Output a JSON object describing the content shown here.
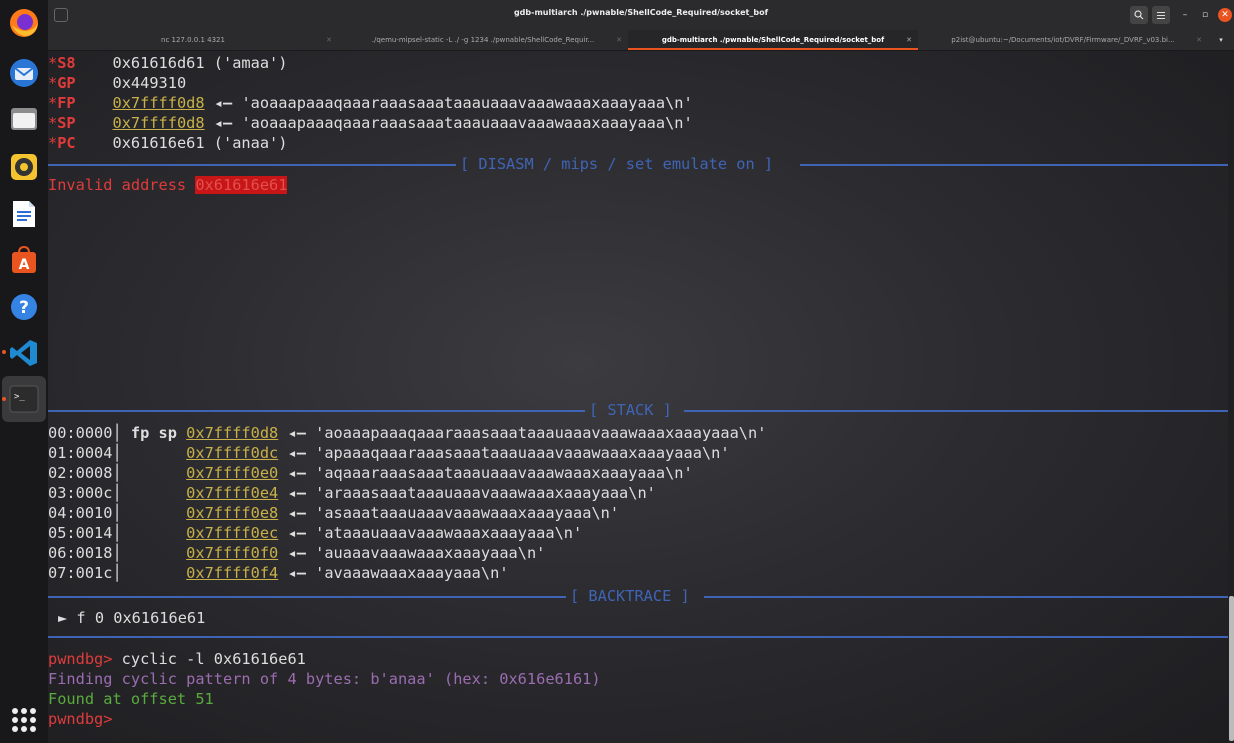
{
  "window": {
    "title": "gdb-multiarch ./pwnable/ShellCode_Required/socket_bof"
  },
  "tabs": [
    {
      "label": "nc 127.0.0.1 4321"
    },
    {
      "label": "./qemu-mipsel-static -L ./ -g 1234 ./pwnable/ShellCode_Requir..."
    },
    {
      "label": "gdb-multiarch ./pwnable/ShellCode_Required/socket_bof"
    },
    {
      "label": "p2ist@ubuntu:~/Documents/iot/DVRF/Firmware/_DVRF_v03.bi..."
    }
  ],
  "registers": [
    {
      "star": "*",
      "name": "S8",
      "value": "0x61616d61 ('amaa')"
    },
    {
      "star": "*",
      "name": "GP",
      "value": "0x449310"
    },
    {
      "star": "*",
      "name": "FP",
      "addr": "0x7ffff0d8",
      "str": "'aoaaapaaaqaaaraaasaaataaauaaavaaawaaaxaaayaaa\\n'"
    },
    {
      "star": "*",
      "name": "SP",
      "addr": "0x7ffff0d8",
      "str": "'aoaaapaaaqaaaraaasaaataaauaaavaaawaaaxaaayaaa\\n'"
    },
    {
      "star": "*",
      "name": "PC",
      "value": "0x61616e61 ('anaa')"
    }
  ],
  "arrow": "◂—",
  "disasm": {
    "header": "[ DISASM / mips / set emulate on ]",
    "invalid_text": "Invalid address",
    "invalid_addr": "0x61616e61"
  },
  "stack": {
    "header": "[ STACK ]",
    "rows": [
      {
        "idx": "00:0000",
        "tag": "fp sp",
        "addr": "0x7ffff0d8",
        "str": "'aoaaapaaaqaaaraaasaaataaauaaavaaawaaaxaaayaaa\\n'"
      },
      {
        "idx": "01:0004",
        "tag": "",
        "addr": "0x7ffff0dc",
        "str": "'apaaaqaaaraaasaaataaauaaavaaawaaaxaaayaaa\\n'"
      },
      {
        "idx": "02:0008",
        "tag": "",
        "addr": "0x7ffff0e0",
        "str": "'aqaaaraaasaaataaauaaavaaawaaaxaaayaaa\\n'"
      },
      {
        "idx": "03:000c",
        "tag": "",
        "addr": "0x7ffff0e4",
        "str": "'araaasaaataaauaaavaaawaaaxaaayaaa\\n'"
      },
      {
        "idx": "04:0010",
        "tag": "",
        "addr": "0x7ffff0e8",
        "str": "'asaaataaauaaavaaawaaaxaaayaaa\\n'"
      },
      {
        "idx": "05:0014",
        "tag": "",
        "addr": "0x7ffff0ec",
        "str": "'ataaauaaavaaawaaaxaaayaaa\\n'"
      },
      {
        "idx": "06:0018",
        "tag": "",
        "addr": "0x7ffff0f0",
        "str": "'auaaavaaawaaaxaaayaaa\\n'"
      },
      {
        "idx": "07:001c",
        "tag": "",
        "addr": "0x7ffff0f4",
        "str": "'avaaawaaaxaaayaaa\\n'"
      }
    ]
  },
  "backtrace": {
    "header": "[ BACKTRACE ]",
    "entry": "► f 0 0x61616e61"
  },
  "console": {
    "prompt": "pwndbg>",
    "command": " cyclic -l 0x61616e61",
    "finding": "Finding cyclic pattern of 4 bytes: b'anaa' (hex: 0x616e6161)",
    "found": "Found at offset 51",
    "prompt2": "pwndbg>"
  },
  "colors": {
    "accent": "#e95420",
    "register_name": "#e03b3b",
    "address": "#c8b14a",
    "separator": "#3f64b5",
    "found": "#5aab3e",
    "finding": "#9b6cb1"
  },
  "dock": [
    {
      "icon": "firefox-icon"
    },
    {
      "icon": "thunderbird-icon"
    },
    {
      "icon": "files-icon"
    },
    {
      "icon": "rhythmbox-icon"
    },
    {
      "icon": "libreoffice-writer-icon"
    },
    {
      "icon": "software-center-icon"
    },
    {
      "icon": "help-icon"
    },
    {
      "icon": "vscode-icon"
    },
    {
      "icon": "terminal-icon"
    }
  ]
}
